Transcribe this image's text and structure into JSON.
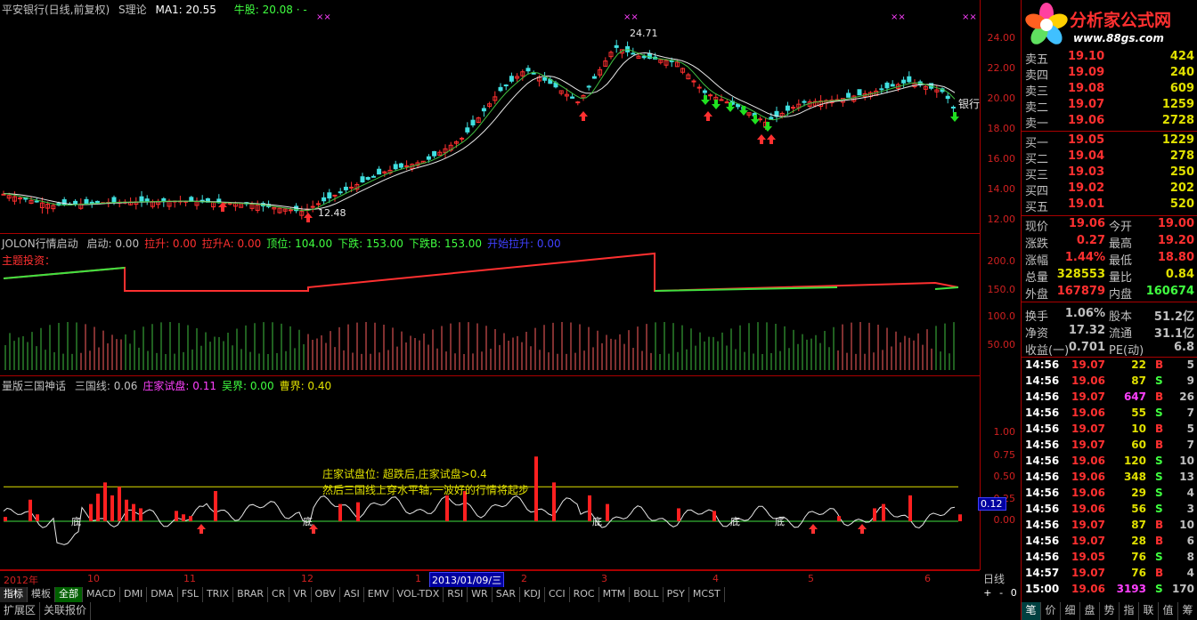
{
  "main_panel": {
    "title": "平安银行(日线,前复权)",
    "theory": "S理论",
    "ma": "MA1: 20.55",
    "bull": "牛股: 20.08 · -",
    "high_label": "24.71",
    "low_label": "12.48",
    "bank_label": "银行",
    "yticks": [
      "24.00",
      "22.00",
      "20.00",
      "18.00",
      "16.00",
      "14.00",
      "12.00"
    ]
  },
  "ind1_panel": {
    "name": "JOLON行情启动",
    "items": [
      {
        "text": "启动: 0.00",
        "color": "#c0c0c0"
      },
      {
        "text": "拉升: 0.00",
        "color": "#ff3030"
      },
      {
        "text": "拉升A: 0.00",
        "color": "#ff3030"
      },
      {
        "text": "顶位: 104.00",
        "color": "#40ff40"
      },
      {
        "text": "下跌: 153.00",
        "color": "#40ff40"
      },
      {
        "text": "下跌B: 153.00",
        "color": "#40ff40"
      },
      {
        "text": "开始拉升: 0.00",
        "color": "#4040ff"
      }
    ],
    "subtitle": "主题投资：",
    "yticks": [
      "200.0",
      "150.0",
      "100.0",
      "50.00"
    ]
  },
  "ind2_panel": {
    "name": "量版三国神话",
    "items": [
      {
        "text": "三国线: 0.06",
        "color": "#c0c0c0"
      },
      {
        "text": "庄家试盘: 0.11",
        "color": "#ff40ff"
      },
      {
        "text": "吴界: 0.00",
        "color": "#40ff40"
      },
      {
        "text": "曹界: 0.40",
        "color": "#e0e000"
      }
    ],
    "note1": "庄家试盘位: 超跌后,庄家试盘>0.4",
    "note2": "然后三国线上穿水平轴,一波好的行情将起步",
    "bottom_label": "底",
    "yticks": [
      "1.00",
      "0.75",
      "0.50",
      "0.25",
      "0.00"
    ],
    "current": "0.12"
  },
  "dates": [
    {
      "text": "2012年"
    },
    {
      "text": "10"
    },
    {
      "text": "11"
    },
    {
      "text": "12"
    },
    {
      "text": "1"
    },
    {
      "text": "2"
    },
    {
      "text": "3"
    },
    {
      "text": "4"
    },
    {
      "text": "5"
    },
    {
      "text": "6"
    }
  ],
  "date_cursor": "2013/01/09/三",
  "period": "日线",
  "zoom": [
    "+",
    "-",
    "0"
  ],
  "tabs": [
    "指标",
    "模板",
    "全部",
    "MACD",
    "DMI",
    "DMA",
    "FSL",
    "TRIX",
    "BRAR",
    "CR",
    "VR",
    "OBV",
    "ASI",
    "EMV",
    "VOL-TDX",
    "RSI",
    "WR",
    "SAR",
    "KDJ",
    "CCI",
    "ROC",
    "MTM",
    "BOLL",
    "PSY",
    "MCST"
  ],
  "tabs2": [
    "扩展区",
    "关联报价"
  ],
  "logo": {
    "title": "分析家公式网",
    "url": "www.88gs.com"
  },
  "asks": [
    {
      "label": "卖五",
      "price": "19.10",
      "vol": "424"
    },
    {
      "label": "卖四",
      "price": "19.09",
      "vol": "240"
    },
    {
      "label": "卖三",
      "price": "19.08",
      "vol": "609"
    },
    {
      "label": "卖二",
      "price": "19.07",
      "vol": "1259"
    },
    {
      "label": "卖一",
      "price": "19.06",
      "vol": "2728"
    }
  ],
  "bids": [
    {
      "label": "买一",
      "price": "19.05",
      "vol": "1229"
    },
    {
      "label": "买二",
      "price": "19.04",
      "vol": "278"
    },
    {
      "label": "买三",
      "price": "19.03",
      "vol": "250"
    },
    {
      "label": "买四",
      "price": "19.02",
      "vol": "202"
    },
    {
      "label": "买五",
      "price": "19.01",
      "vol": "520"
    }
  ],
  "quotes": [
    {
      "l1": "现价",
      "v1": "19.06",
      "c1": "#ff3030",
      "l2": "今开",
      "v2": "19.00",
      "c2": "#ff3030"
    },
    {
      "l1": "涨跌",
      "v1": "0.27",
      "c1": "#ff3030",
      "l2": "最高",
      "v2": "19.20",
      "c2": "#ff3030"
    },
    {
      "l1": "涨幅",
      "v1": "1.44%",
      "c1": "#ff3030",
      "l2": "最低",
      "v2": "18.80",
      "c2": "#ff3030"
    },
    {
      "l1": "总量",
      "v1": "328553",
      "c1": "#e0e000",
      "l2": "量比",
      "v2": "0.84",
      "c2": "#e0e000"
    },
    {
      "l1": "外盘",
      "v1": "167879",
      "c1": "#ff3030",
      "l2": "内盘",
      "v2": "160674",
      "c2": "#40ff40"
    },
    {
      "l1": "换手",
      "v1": "1.06%",
      "c1": "#c0c0c0",
      "l2": "股本",
      "v2": "51.2亿",
      "c2": "#c0c0c0"
    },
    {
      "l1": "净资",
      "v1": "17.32",
      "c1": "#c0c0c0",
      "l2": "流通",
      "v2": "31.1亿",
      "c2": "#c0c0c0"
    },
    {
      "l1": "收益(一)",
      "v1": "0.701",
      "c1": "#c0c0c0",
      "l2": "PE(动)",
      "v2": "6.8",
      "c2": "#c0c0c0"
    }
  ],
  "ticks": [
    {
      "t": "14:56",
      "p": "19.07",
      "v": "22",
      "s": "B",
      "n": "5"
    },
    {
      "t": "14:56",
      "p": "19.06",
      "v": "87",
      "s": "S",
      "n": "9"
    },
    {
      "t": "14:56",
      "p": "19.07",
      "v": "647",
      "s": "B",
      "n": "26"
    },
    {
      "t": "14:56",
      "p": "19.06",
      "v": "55",
      "s": "S",
      "n": "7"
    },
    {
      "t": "14:56",
      "p": "19.07",
      "v": "10",
      "s": "B",
      "n": "5"
    },
    {
      "t": "14:56",
      "p": "19.07",
      "v": "60",
      "s": "B",
      "n": "7"
    },
    {
      "t": "14:56",
      "p": "19.06",
      "v": "120",
      "s": "S",
      "n": "10"
    },
    {
      "t": "14:56",
      "p": "19.06",
      "v": "348",
      "s": "S",
      "n": "13"
    },
    {
      "t": "14:56",
      "p": "19.06",
      "v": "29",
      "s": "S",
      "n": "4"
    },
    {
      "t": "14:56",
      "p": "19.06",
      "v": "56",
      "s": "S",
      "n": "3"
    },
    {
      "t": "14:56",
      "p": "19.07",
      "v": "87",
      "s": "B",
      "n": "10"
    },
    {
      "t": "14:56",
      "p": "19.07",
      "v": "28",
      "s": "B",
      "n": "6"
    },
    {
      "t": "14:56",
      "p": "19.05",
      "v": "76",
      "s": "S",
      "n": "8"
    },
    {
      "t": "14:57",
      "p": "19.07",
      "v": "76",
      "s": "B",
      "n": "4"
    },
    {
      "t": "15:00",
      "p": "19.06",
      "v": "3193",
      "s": "S",
      "n": "170"
    }
  ],
  "side_tabs": [
    "笔",
    "价",
    "细",
    "盘",
    "势",
    "指",
    "联",
    "值",
    "筹"
  ],
  "colors": {
    "up": "#ff3030",
    "down": "#40ff40",
    "axis": "#a00000",
    "white_line": "#e8e8e8"
  }
}
